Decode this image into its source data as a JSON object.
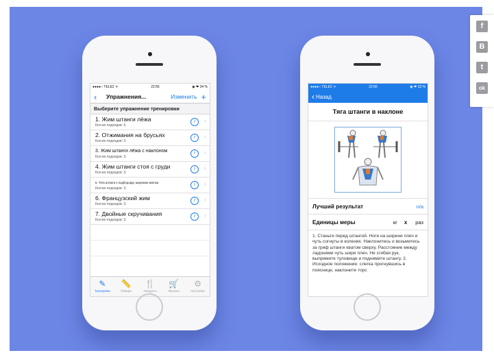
{
  "phone1": {
    "status": {
      "carrier": "●●●●○ TELE2 ᯤ",
      "time": "22:56",
      "battery": "◉ ❤ 34 %"
    },
    "nav": {
      "back": "‹",
      "title": "Упражнения...",
      "edit": "Изменить",
      "add": "+"
    },
    "section_header": "Выберите упражнение тренировки",
    "exercises": [
      {
        "name": "1. Жим штанги лёжа",
        "sub": "Кол-во подходов: 5."
      },
      {
        "name": "2. Отжимания на брусьях",
        "sub": "Кол-во подходов: 3."
      },
      {
        "name": "3. Жим штанги лёжа с наклоном",
        "sub": "Кол-во подходов: 3."
      },
      {
        "name": "4. Жим штанги стоя с груди",
        "sub": "Кол-во подходов: 3."
      },
      {
        "name": "5. Тяга штанги к подбородку широким хватом",
        "sub": "Кол-во подходов: 3."
      },
      {
        "name": "6. Французский жим",
        "sub": "Кол-во подходов: 3."
      },
      {
        "name": "7. Двойные скручивания",
        "sub": "Кол-во подходов: 3."
      }
    ],
    "tabs": [
      {
        "label": "Тренировки",
        "icon": "✎"
      },
      {
        "label": "Обмеры",
        "icon": "📏"
      },
      {
        "label": "Продукты",
        "icon": "🍴"
      },
      {
        "label": "Магазин",
        "icon": "🛒"
      },
      {
        "label": "Настройки",
        "icon": "⚙"
      }
    ]
  },
  "phone2": {
    "status": {
      "carrier": "●●●●○ TELE2 ᯤ",
      "time": "22:56",
      "battery": "◉ ❤ 33 %"
    },
    "nav": {
      "back_icon": "‹",
      "back": "Назад"
    },
    "title": "Тяга штанги в наклоне",
    "best_label": "Лучший результат",
    "best_value": "n/a",
    "units_label": "Единицы меры",
    "unit_kg": "кг",
    "unit_x": "x",
    "unit_reps": "раз",
    "description": "1. Станьте перед штангой. Ноги на ширине плеч и чуть согнуты в коленях. Наклонитесь и возьмитесь за гриф штанги хватом сверху. Расстояние между ладонями чуть шире плеч. Не сгибая рук, выпрямите туловище и поднимите штангу. 2. Исходное положение: слегка прогнувшись в пояснице, наклоните торс"
  },
  "social": [
    {
      "icon": "facebook-icon",
      "glyph": "f"
    },
    {
      "icon": "vk-icon",
      "glyph": "B"
    },
    {
      "icon": "twitter-icon",
      "glyph": "t"
    },
    {
      "icon": "odnoklassniki-icon",
      "glyph": "ok"
    }
  ],
  "colors": {
    "background": "#6c86e6",
    "accent": "#1e7ce8"
  }
}
